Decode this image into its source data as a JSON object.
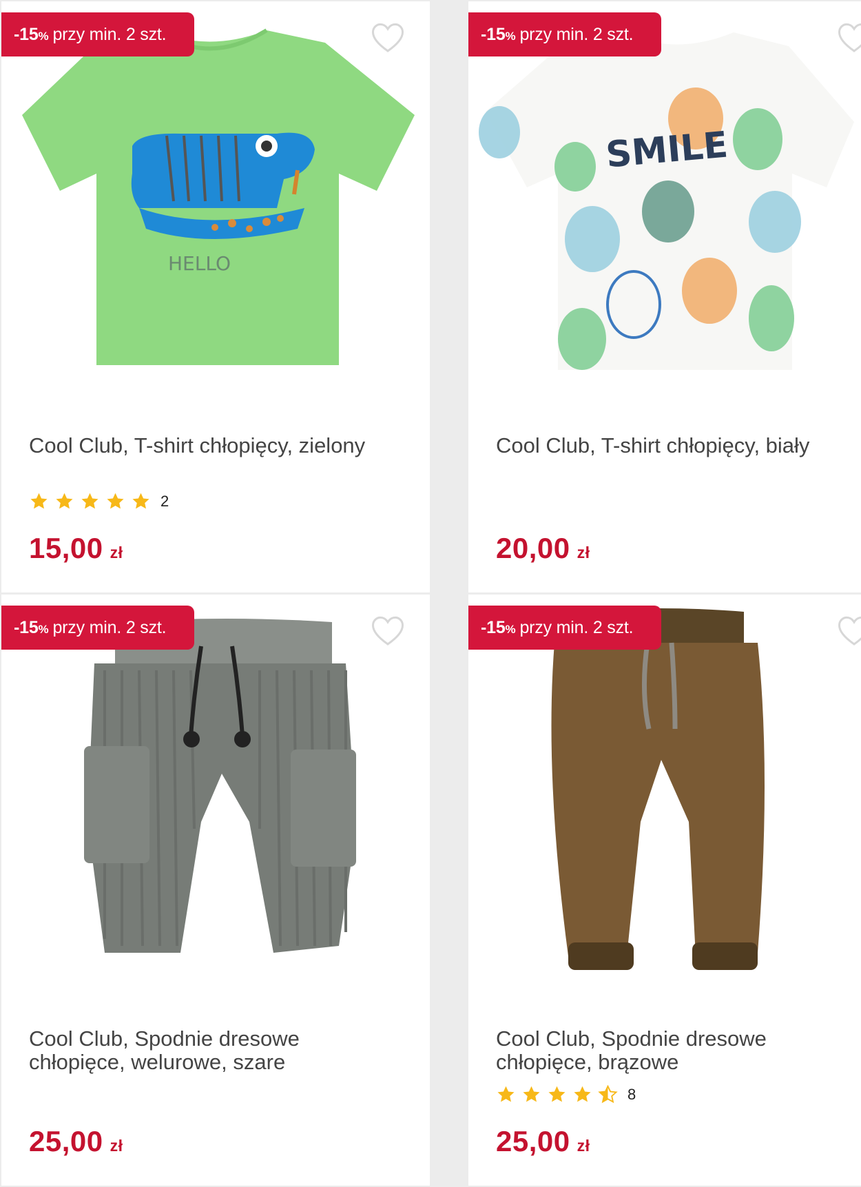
{
  "products": [
    {
      "badge_pct": "-15",
      "badge_pct_sign": "%",
      "badge_rest": "przy min. 2 szt.",
      "title": "Cool Club, T-shirt chłopięcy, zielony",
      "rating": 5,
      "reviews": "2",
      "price": "15,00",
      "currency": "zł",
      "image": "green-tshirt-lizard",
      "image_text": "HELLO"
    },
    {
      "badge_pct": "-15",
      "badge_pct_sign": "%",
      "badge_rest": "przy min. 2 szt.",
      "title": "Cool Club, T-shirt chłopięcy, biały",
      "price": "20,00",
      "currency": "zł",
      "image": "white-tshirt-pineapples",
      "image_text": "SMILE"
    },
    {
      "badge_pct": "-15",
      "badge_pct_sign": "%",
      "badge_rest": "przy min. 2 szt.",
      "title_line1": "Cool Club, Spodnie dresowe",
      "title_line2": "chłopięce, welurowe, szare",
      "price": "25,00",
      "currency": "zł",
      "image": "grey-corduroy-pants"
    },
    {
      "badge_pct": "-15",
      "badge_pct_sign": "%",
      "badge_rest": "przy min. 2 szt.",
      "title_line1": "Cool Club, Spodnie dresowe",
      "title_line2": "chłopięce, brązowe",
      "rating": 4.5,
      "reviews": "8",
      "price": "25,00",
      "currency": "zł",
      "image": "brown-fleece-pants"
    }
  ],
  "colors": {
    "badge": "#d4163b",
    "price": "#c4122f",
    "star": "#f7b818",
    "background": "#ececec"
  }
}
